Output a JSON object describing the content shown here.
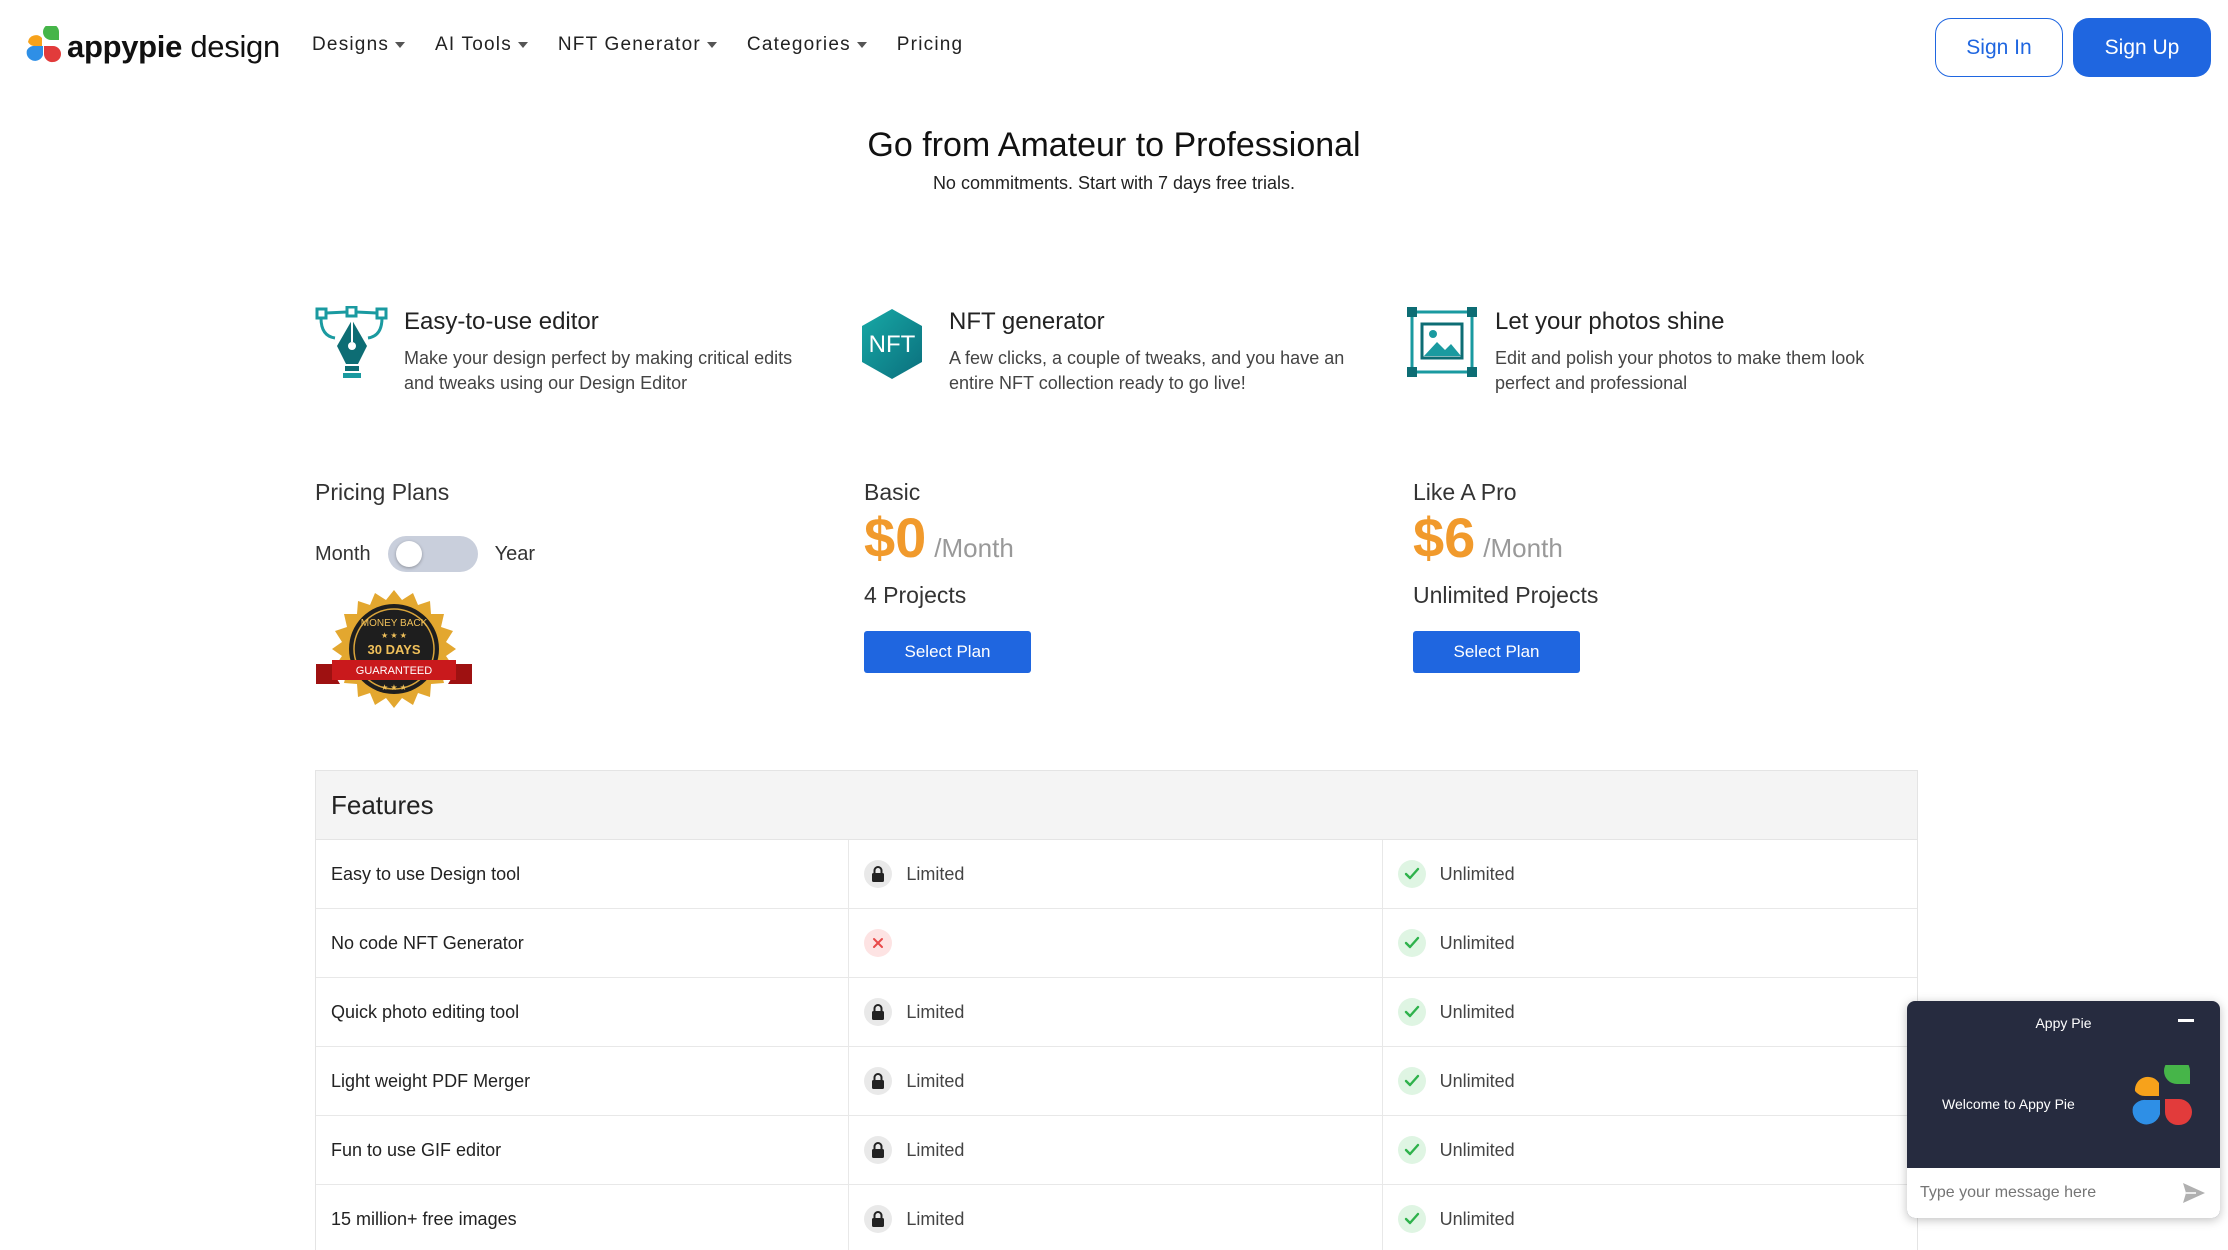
{
  "header": {
    "logo_bold": "appypie",
    "logo_light": " design",
    "nav": [
      {
        "label": "Designs",
        "dropdown": true
      },
      {
        "label": "AI Tools",
        "dropdown": true
      },
      {
        "label": "NFT Generator",
        "dropdown": true
      },
      {
        "label": "Categories",
        "dropdown": true
      },
      {
        "label": "Pricing",
        "dropdown": false
      }
    ],
    "signin_label": "Sign In",
    "signup_label": "Sign Up"
  },
  "hero": {
    "title": "Go from Amateur to Professional",
    "subtitle": "No commitments. Start with 7 days free trials."
  },
  "highlights": [
    {
      "title": "Easy-to-use editor",
      "description": "Make your design perfect by making critical edits and tweaks using our Design Editor",
      "icon": "pen-tool-icon"
    },
    {
      "title": "NFT generator",
      "description": "A few clicks, a couple of tweaks, and you have an entire NFT collection ready to go live!",
      "icon": "nft-hexagon-icon"
    },
    {
      "title": "Let your photos shine",
      "description": "Edit and polish your photos to make them look perfect and professional",
      "icon": "photo-frame-icon"
    }
  ],
  "pricing": {
    "title": "Pricing Plans",
    "toggle_left": "Month",
    "toggle_right": "Year",
    "toggle_state": "Month",
    "badge": {
      "top": "MONEY BACK",
      "middle": "30 DAYS",
      "bottom": "GUARANTEED"
    },
    "plans": [
      {
        "name": "Basic",
        "amount": "$0",
        "period": "/Month",
        "projects": "4 Projects",
        "button": "Select Plan"
      },
      {
        "name": "Like A Pro",
        "amount": "$6",
        "period": "/Month",
        "projects": "Unlimited Projects",
        "button": "Select Plan"
      }
    ]
  },
  "features": {
    "heading": "Features",
    "rows": [
      {
        "name": "Easy to use Design tool",
        "basic": {
          "icon": "lock-icon",
          "text": "Limited"
        },
        "pro": {
          "icon": "check-icon",
          "text": "Unlimited"
        }
      },
      {
        "name": "No code NFT Generator",
        "basic": {
          "icon": "x-icon",
          "text": ""
        },
        "pro": {
          "icon": "check-icon",
          "text": "Unlimited"
        }
      },
      {
        "name": "Quick photo editing tool",
        "basic": {
          "icon": "lock-icon",
          "text": "Limited"
        },
        "pro": {
          "icon": "check-icon",
          "text": "Unlimited"
        }
      },
      {
        "name": "Light weight PDF Merger",
        "basic": {
          "icon": "lock-icon",
          "text": "Limited"
        },
        "pro": {
          "icon": "check-icon",
          "text": "Unlimited"
        }
      },
      {
        "name": "Fun to use GIF editor",
        "basic": {
          "icon": "lock-icon",
          "text": "Limited"
        },
        "pro": {
          "icon": "check-icon",
          "text": "Unlimited"
        }
      },
      {
        "name": "15 million+ free images",
        "basic": {
          "icon": "lock-icon",
          "text": "Limited"
        },
        "pro": {
          "icon": "check-icon",
          "text": "Unlimited"
        }
      }
    ]
  },
  "chat": {
    "title": "Appy Pie",
    "welcome": "Welcome to Appy Pie",
    "placeholder": "Type your message here"
  },
  "colors": {
    "primary": "#1f66e0",
    "price": "#f19a2c",
    "chat_bg": "#262b3f",
    "check_green": "#2fb24c",
    "x_red": "#e84a4a"
  }
}
